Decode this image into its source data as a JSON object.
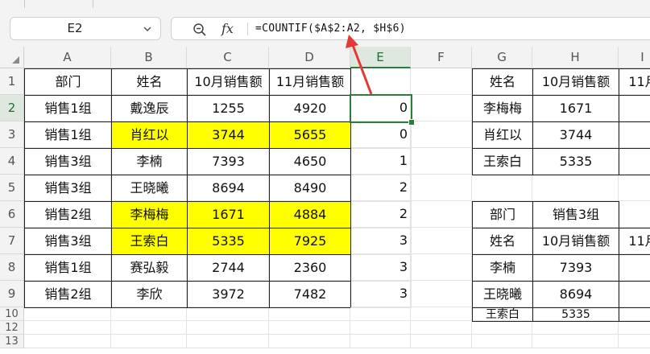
{
  "name_box": {
    "value": "E2"
  },
  "formula_bar": {
    "fx_label": "fx",
    "formula": "=COUNTIF($A$2:A2, $H$6)"
  },
  "columns": [
    "A",
    "B",
    "C",
    "D",
    "E",
    "F",
    "G",
    "H",
    "I"
  ],
  "selected_column": "E",
  "rows": [
    "1",
    "2",
    "3",
    "4",
    "5",
    "6",
    "7",
    "8",
    "9",
    "10",
    "12",
    "13"
  ],
  "selected_row": "2",
  "selected_cell": "E2",
  "highlight_color": "#ffff00",
  "selection_color": "#2a7d3a",
  "arrow_color": "#e53935",
  "main_table": {
    "headers": [
      "部门",
      "姓名",
      "10月销售额",
      "11月销售额"
    ],
    "rows": [
      {
        "dept": "销售1组",
        "name": "戴逸辰",
        "oct": "1255",
        "nov": "4920",
        "e": "0",
        "highlight": false
      },
      {
        "dept": "销售1组",
        "name": "肖红以",
        "oct": "3744",
        "nov": "5655",
        "e": "0",
        "highlight": true
      },
      {
        "dept": "销售3组",
        "name": "李楠",
        "oct": "7393",
        "nov": "4650",
        "e": "1",
        "highlight": false
      },
      {
        "dept": "销售3组",
        "name": "王晓曦",
        "oct": "8694",
        "nov": "8490",
        "e": "2",
        "highlight": false
      },
      {
        "dept": "销售2组",
        "name": "李梅梅",
        "oct": "1671",
        "nov": "4884",
        "e": "2",
        "highlight": true
      },
      {
        "dept": "销售3组",
        "name": "王索白",
        "oct": "5335",
        "nov": "7925",
        "e": "3",
        "highlight": true
      },
      {
        "dept": "销售1组",
        "name": "赛弘毅",
        "oct": "2744",
        "nov": "2360",
        "e": "3",
        "highlight": false
      },
      {
        "dept": "销售2组",
        "name": "李欣",
        "oct": "3972",
        "nov": "7482",
        "e": "3",
        "highlight": false
      }
    ]
  },
  "lookup_table_1": {
    "headers": [
      "姓名",
      "10月销售额",
      "11月"
    ],
    "rows": [
      {
        "name": "李梅梅",
        "oct": "1671"
      },
      {
        "name": "肖红以",
        "oct": "3744"
      },
      {
        "name": "王索白",
        "oct": "5335"
      }
    ]
  },
  "lookup_table_2": {
    "dept_label": "部门",
    "dept_value": "销售3组",
    "headers": [
      "姓名",
      "10月销售额",
      "11月"
    ],
    "rows": [
      {
        "name": "李楠",
        "oct": "7393"
      },
      {
        "name": "王晓曦",
        "oct": "8694"
      },
      {
        "name": "王索白",
        "oct": "5335"
      }
    ]
  }
}
